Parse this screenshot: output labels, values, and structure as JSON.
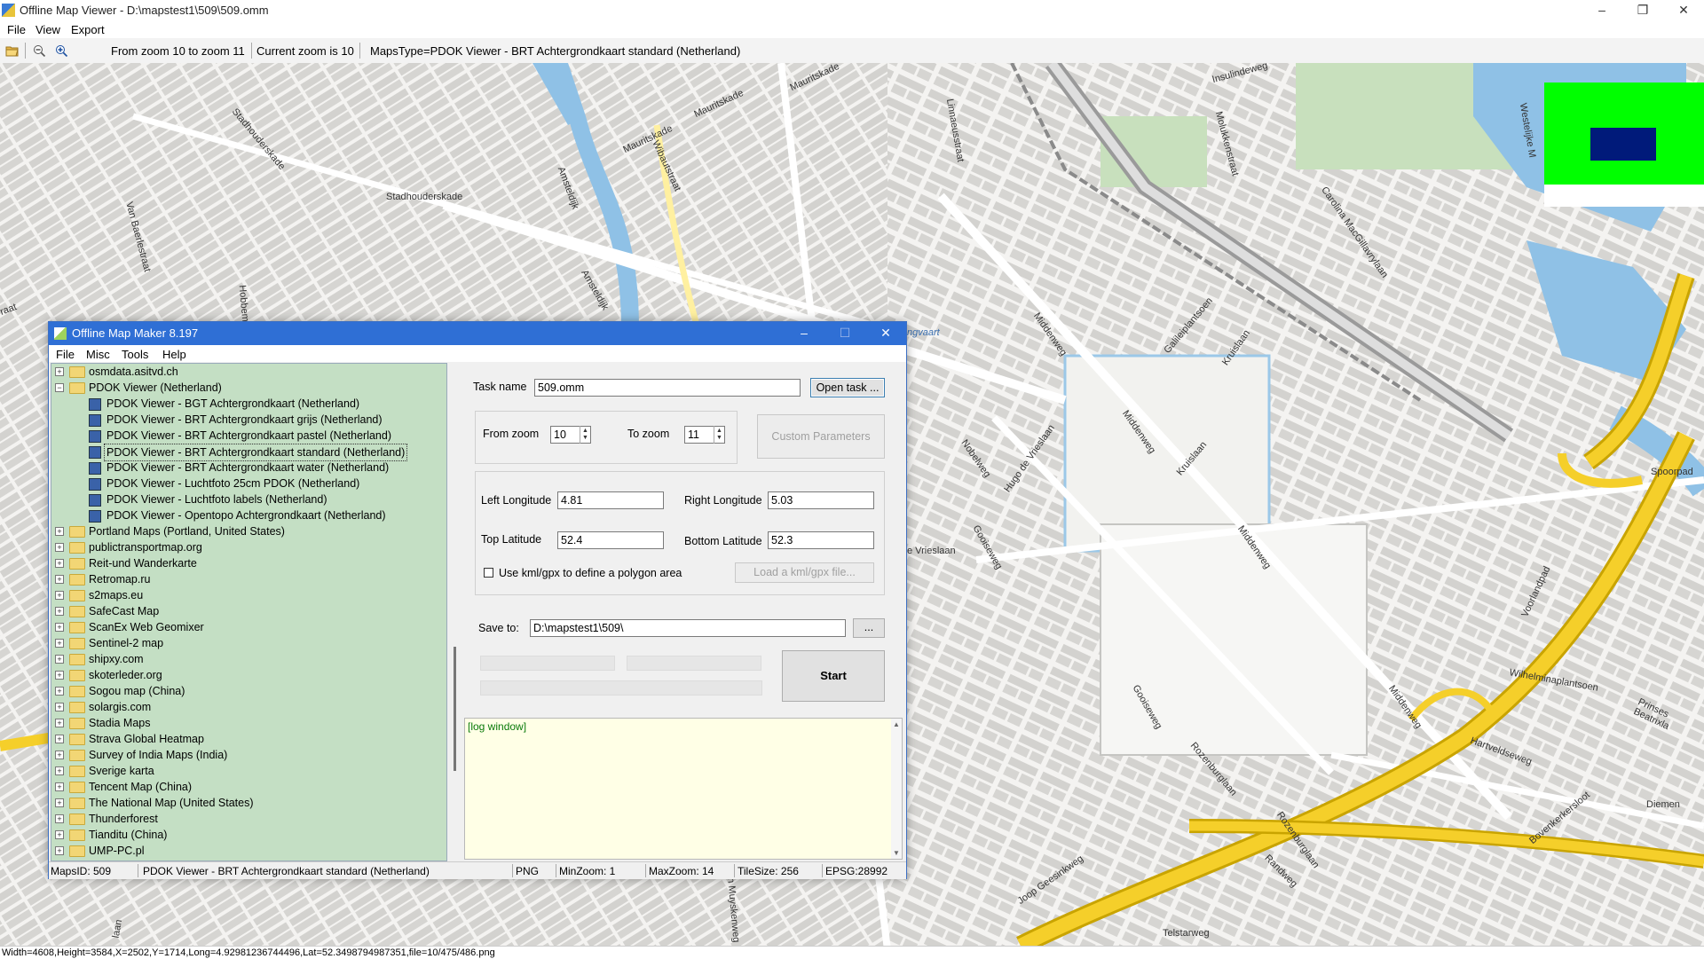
{
  "window": {
    "title": "Offline Map Viewer - D:\\mapstest1\\509\\509.omm",
    "minimize": "–",
    "maximize": "❐",
    "close": "✕"
  },
  "menu": [
    "File",
    "View",
    "Export"
  ],
  "toolbar": {
    "zoom_range": "From zoom 10 to zoom 11",
    "current_zoom": "Current zoom is 10",
    "maps_type": "MapsType=PDOK Viewer - BRT Achtergrondkaart standard (Netherland)"
  },
  "map": {
    "labels": [
      "Stadhouderskade",
      "Stadhouderskade",
      "Mauritskade",
      "Mauritskade",
      "Mauritskade",
      "Wibautstraat",
      "Amsteldijk",
      "Amsteldijk",
      "Van Baerlestraat",
      "Hobbemakade",
      "Insulindeweg",
      "Linnaeusstraat",
      "Molukkenstraat",
      "Carolina MacGillavrylaan",
      "Galileiplantsoen",
      "Kruislaan",
      "Middenweg",
      "Middenweg",
      "Middenweg",
      "Middenweg",
      "Hugo de Vrieslaan",
      "Nobelweg",
      "Gooiseweg",
      "Gooiseweg",
      "Kruislaan",
      "Spoorpad",
      "Voorlandpad",
      "Wilhelminaplantsoen",
      "Prinses Beatrixla",
      "Hartveldseweg",
      "Rozenburglaan",
      "Rozenburglaan",
      "Randweg",
      "Joop Geesinkweg",
      "Telstarweg",
      "Bovenkerkersloot",
      "Diemen",
      "Joan Muyskenweg",
      "Westelijke M",
      "e Vrieslaan",
      "ngvaart",
      "raat",
      "laan"
    ]
  },
  "status_bar": "Width=4608,Height=3584,X=2502,Y=1714,Long=4.92981236744496,Lat=52.3498794987351,file=10/475/486.png",
  "dialog": {
    "title": "Offline Map Maker 8.197",
    "minimize": "–",
    "maximize": "☐",
    "close": "✕",
    "menu": [
      "File",
      "Misc",
      "Tools",
      "Help"
    ],
    "tree": [
      {
        "level": 0,
        "expander": "+",
        "label": "osmdata.asitvd.ch"
      },
      {
        "level": 0,
        "expander": "−",
        "label": "PDOK Viewer (Netherland)",
        "open": true
      },
      {
        "level": 1,
        "label": "PDOK Viewer - BGT Achtergrondkaart (Netherland)"
      },
      {
        "level": 1,
        "label": "PDOK Viewer - BRT Achtergrondkaart grijs (Netherland)"
      },
      {
        "level": 1,
        "label": "PDOK Viewer - BRT Achtergrondkaart pastel (Netherland)"
      },
      {
        "level": 1,
        "label": "PDOK Viewer - BRT Achtergrondkaart standard (Netherland)",
        "selected": true
      },
      {
        "level": 1,
        "label": "PDOK Viewer - BRT Achtergrondkaart water (Netherland)"
      },
      {
        "level": 1,
        "label": "PDOK Viewer - Luchtfoto 25cm PDOK (Netherland)"
      },
      {
        "level": 1,
        "label": "PDOK Viewer - Luchtfoto labels (Netherland)"
      },
      {
        "level": 1,
        "label": "PDOK Viewer - Opentopo Achtergrondkaart (Netherland)"
      },
      {
        "level": 0,
        "expander": "+",
        "label": "Portland Maps (Portland, United States)"
      },
      {
        "level": 0,
        "expander": "+",
        "label": "publictransportmap.org"
      },
      {
        "level": 0,
        "expander": "+",
        "label": "Reit-und Wanderkarte"
      },
      {
        "level": 0,
        "expander": "+",
        "label": "Retromap.ru"
      },
      {
        "level": 0,
        "expander": "+",
        "label": "s2maps.eu"
      },
      {
        "level": 0,
        "expander": "+",
        "label": "SafeCast Map"
      },
      {
        "level": 0,
        "expander": "+",
        "label": "ScanEx Web Geomixer"
      },
      {
        "level": 0,
        "expander": "+",
        "label": "Sentinel-2 map"
      },
      {
        "level": 0,
        "expander": "+",
        "label": "shipxy.com"
      },
      {
        "level": 0,
        "expander": "+",
        "label": "skoterleder.org"
      },
      {
        "level": 0,
        "expander": "+",
        "label": "Sogou map (China)"
      },
      {
        "level": 0,
        "expander": "+",
        "label": "solargis.com"
      },
      {
        "level": 0,
        "expander": "+",
        "label": "Stadia Maps"
      },
      {
        "level": 0,
        "expander": "+",
        "label": "Strava Global Heatmap"
      },
      {
        "level": 0,
        "expander": "+",
        "label": "Survey of India Maps (India)"
      },
      {
        "level": 0,
        "expander": "+",
        "label": "Sverige karta"
      },
      {
        "level": 0,
        "expander": "+",
        "label": "Tencent Map (China)"
      },
      {
        "level": 0,
        "expander": "+",
        "label": "The National Map (United States)"
      },
      {
        "level": 0,
        "expander": "+",
        "label": "Thunderforest"
      },
      {
        "level": 0,
        "expander": "+",
        "label": "Tianditu (China)"
      },
      {
        "level": 0,
        "expander": "+",
        "label": "UMP-PC.pl"
      }
    ],
    "form": {
      "task_name_label": "Task name",
      "task_name_value": "509.omm",
      "open_task": "Open task ...",
      "from_zoom_label": "From zoom",
      "from_zoom_value": "10",
      "to_zoom_label": "To zoom",
      "to_zoom_value": "11",
      "custom_parameters": "Custom Parameters",
      "left_lon_label": "Left Longitude",
      "left_lon_value": "4.81",
      "right_lon_label": "Right Longitude",
      "right_lon_value": "5.03",
      "top_lat_label": "Top Latitude",
      "top_lat_value": "52.4",
      "bottom_lat_label": "Bottom Latitude",
      "bottom_lat_value": "52.3",
      "kml_checkbox_label": "Use kml/gpx to define a polygon area",
      "load_kml": "Load a kml/gpx file...",
      "save_to_label": "Save to:",
      "save_to_value": "D:\\mapstest1\\509\\",
      "browse": "...",
      "start": "Start",
      "log": "[log window]"
    },
    "status": {
      "maps_id": "MapsID: 509",
      "name": "PDOK Viewer - BRT Achtergrondkaart standard (Netherland)",
      "format": "PNG",
      "min_zoom": "MinZoom: 1",
      "max_zoom": "MaxZoom: 14",
      "tile_size": "TileSize: 256",
      "epsg": "EPSG:28992"
    }
  },
  "colors": {
    "water": "#8fc1e6",
    "motorway": "#f5cf2a",
    "road": "#ffffff",
    "building": "#d3d2cf",
    "green": "#c8e0bd",
    "tree_bg": "#c4dfc4",
    "overview_bg": "#00ff00",
    "overview_rect": "#001a7a"
  }
}
